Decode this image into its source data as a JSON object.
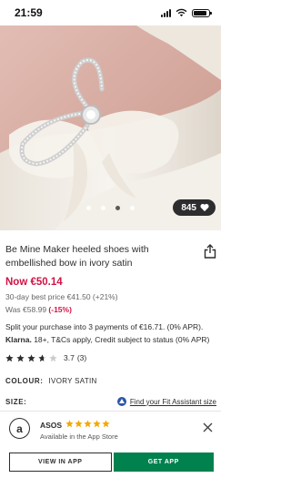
{
  "status_bar": {
    "time": "21:59"
  },
  "gallery": {
    "save_count": "845",
    "slides": 4,
    "active_slide": 3
  },
  "product": {
    "title": "Be Mine Maker heeled shoes with embellished bow in ivory satin",
    "price_now": "Now €50.14",
    "best_price": "30-day best price €41.50 (+21%)",
    "was_label": "Was €58.99 ",
    "was_pct": "(-15%)",
    "split_payment": "Split your purchase into 3 payments of €16.71. (0% APR).",
    "klarna_brand": "Klarna.",
    "klarna_text": " 18+, T&Cs apply, Credit subject to status (0% APR)",
    "rating_value": "3.7",
    "rating_count": "(3)",
    "rating_stars": 3.7,
    "colour_label": "COLOUR:",
    "colour_value": "IVORY SATIN",
    "size_label": "SIZE:",
    "fit_link": "Find your Fit Assistant size"
  },
  "app_banner": {
    "logo_letter": "a",
    "app_name": "ASOS",
    "subtitle": "Available in the App Store",
    "view_button": "VIEW IN APP",
    "get_button": "GET APP",
    "stars": 5
  },
  "colors": {
    "sale_red": "#d01345",
    "app_green": "#01814e",
    "text_dark": "#2d2d2d",
    "fit_blue": "#2d57a8"
  }
}
